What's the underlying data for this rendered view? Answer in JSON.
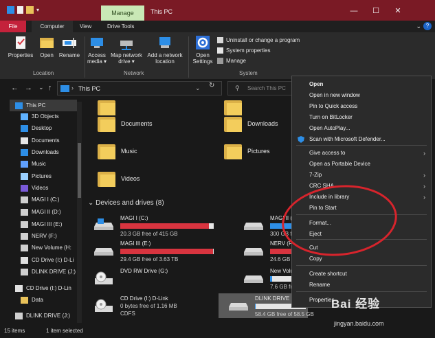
{
  "window": {
    "title": "This PC",
    "manage_tab": "Manage",
    "controls": {
      "minimize": "—",
      "maximize": "☐",
      "close": "✕"
    }
  },
  "ribbon_tabs": {
    "file": "File",
    "computer": "Computer",
    "view": "View",
    "drive_tools": "Drive Tools",
    "expand": "⌄",
    "help": "?"
  },
  "ribbon": {
    "location": {
      "label": "Location",
      "properties": "Properties",
      "open": "Open",
      "rename": "Rename"
    },
    "network": {
      "label": "Network",
      "access_media": "Access media ▾",
      "map_network_drive": "Map network drive ▾",
      "add_network_location": "Add a network location"
    },
    "system": {
      "label": "System",
      "open_settings": "Open Settings",
      "uninstall": "Uninstall or change a program",
      "system_properties": "System properties",
      "manage": "Manage"
    }
  },
  "address_bar": {
    "back": "←",
    "forward": "→",
    "recent": "⌄",
    "up": "↑",
    "path": "This PC",
    "path_chevron": "›",
    "refresh": "↻",
    "search_placeholder": "Search This PC"
  },
  "nav_pane": [
    {
      "label": "This PC",
      "icon": "pc-icon",
      "selected": true
    },
    {
      "label": "3D Objects",
      "icon": "cube-icon"
    },
    {
      "label": "Desktop",
      "icon": "desktop-icon"
    },
    {
      "label": "Documents",
      "icon": "document-icon"
    },
    {
      "label": "Downloads",
      "icon": "download-icon"
    },
    {
      "label": "Music",
      "icon": "music-icon"
    },
    {
      "label": "Pictures",
      "icon": "picture-icon"
    },
    {
      "label": "Videos",
      "icon": "video-icon"
    },
    {
      "label": "MAGI I (C:)",
      "icon": "drive-icon"
    },
    {
      "label": "MAGI II (D:)",
      "icon": "drive-icon"
    },
    {
      "label": "MAGI III (E:)",
      "icon": "drive-icon"
    },
    {
      "label": "NERV (F:)",
      "icon": "drive-icon"
    },
    {
      "label": "New Volume (H:",
      "icon": "drive-icon"
    },
    {
      "label": "CD Drive (I:) D-Li",
      "icon": "cd-icon"
    },
    {
      "label": "DLINK DRIVE (J:)",
      "icon": "drive-icon"
    },
    {
      "label": "CD Drive (I:) D-Lin",
      "icon": "cd-icon"
    },
    {
      "label": "Data",
      "icon": "folder-icon"
    },
    {
      "label": "DLINK DRIVE (J:)",
      "icon": "drive-icon"
    }
  ],
  "folders": [
    {
      "label": "Documents"
    },
    {
      "label": "Downloads"
    },
    {
      "label": "Music"
    },
    {
      "label": "Pictures"
    },
    {
      "label": "Videos"
    }
  ],
  "devices_header": "Devices and drives (8)",
  "drives": [
    {
      "name": "MAGI I (C:)",
      "free": "20.3 GB free of 415 GB",
      "used_fraction": 0.95,
      "bar_color": "#d8343f"
    },
    {
      "name": "MAGI II (D:)",
      "free": "300 GB free of 93",
      "used_fraction": 0.68,
      "bar_color": "#2d8ee6"
    },
    {
      "name": "MAGI III (E:)",
      "free": "29.4 GB free of 3.63 TB",
      "used_fraction": 0.99,
      "bar_color": "#d8343f"
    },
    {
      "name": "NERV (F:)",
      "free": "24.6 GB free of 46",
      "used_fraction": 0.95,
      "bar_color": "#d8343f"
    },
    {
      "name": "DVD RW Drive (G:)",
      "free": "",
      "used_fraction": null,
      "bar_color": ""
    },
    {
      "name": "New Volume (H:",
      "free": "7.6 GB free of 7.6",
      "used_fraction": 0.02,
      "bar_color": "#2d8ee6"
    },
    {
      "name": "CD Drive (I:) D-Link",
      "free": "0 bytes free of 1.16 MB",
      "extra": "CDFS",
      "used_fraction": null,
      "bar_color": ""
    },
    {
      "name": "DLINK DRIVE (J:)",
      "free": "58.4 GB free of 58.5 GB",
      "used_fraction": 0.01,
      "bar_color": "#2d8ee6"
    }
  ],
  "status": {
    "items": "15 items",
    "selected": "1 item selected"
  },
  "context_menu": [
    {
      "label": "Open",
      "bold": true
    },
    {
      "label": "Open in new window"
    },
    {
      "label": "Pin to Quick access"
    },
    {
      "label": "Turn on BitLocker"
    },
    {
      "label": "Open AutoPlay..."
    },
    {
      "label": "Scan with Microsoft Defender...",
      "icon": "shield-icon"
    },
    {
      "label": "Give access to",
      "submenu": true
    },
    {
      "label": "Open as Portable Device"
    },
    {
      "label": "7-Zip",
      "submenu": true
    },
    {
      "label": "CRC SHA",
      "submenu": true
    },
    {
      "label": "Include in library",
      "submenu": true
    },
    {
      "label": "Pin to Start"
    },
    {
      "label": "Format..."
    },
    {
      "label": "Eject"
    },
    {
      "label": "Cut"
    },
    {
      "label": "Copy"
    },
    {
      "label": "Create shortcut"
    },
    {
      "label": "Rename"
    },
    {
      "label": "Properties"
    }
  ],
  "watermark": {
    "logo": "Bai 经验",
    "url": "jingyan.baidu.com"
  },
  "colors": {
    "accent": "#c4223b",
    "frame": "#7a1a25",
    "annotation": "#d7242c"
  }
}
